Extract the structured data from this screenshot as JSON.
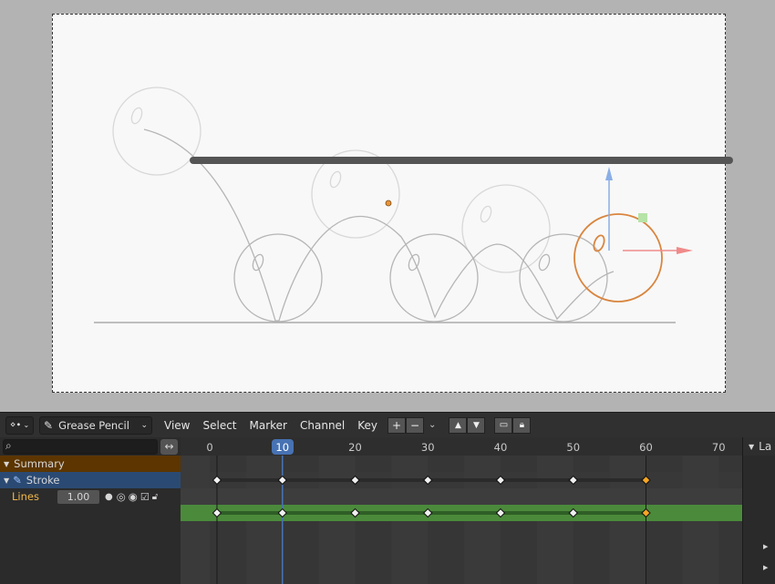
{
  "editor": {
    "mode_label": "Grease Pencil",
    "menu": [
      "View",
      "Select",
      "Marker",
      "Channel",
      "Key"
    ]
  },
  "search": {
    "value": ""
  },
  "channels": {
    "summary": "Summary",
    "object": "Stroke",
    "layer": "Lines",
    "opacity": "1.00"
  },
  "timeline": {
    "ticks": [
      "0",
      "10",
      "20",
      "30",
      "40",
      "50",
      "60",
      "70"
    ],
    "current_frame": "10",
    "current_frame_value": 10,
    "keyframes": [
      1,
      10,
      20,
      30,
      40,
      50,
      60
    ],
    "selected_keyframe": 60
  },
  "side_panel": {
    "label": "La"
  },
  "colors": {
    "summary_bg": "#5c3500",
    "object_bg": "#2b4a73",
    "layer_bg": "#4b8a3b",
    "playhead": "#4772b3",
    "selected_key": "#f5a623",
    "stroke_active": "#d9853f"
  },
  "icons": [
    "dopesheet-icon",
    "pencil-icon",
    "search-icon",
    "swap-icon",
    "plus-icon",
    "minus-icon",
    "up-icon",
    "down-icon",
    "monitor-icon",
    "lock-icon",
    "eye-icon",
    "onion-icon",
    "checkbox-icon",
    "unlock-icon",
    "x-axis-arrow",
    "z-axis-arrow"
  ]
}
